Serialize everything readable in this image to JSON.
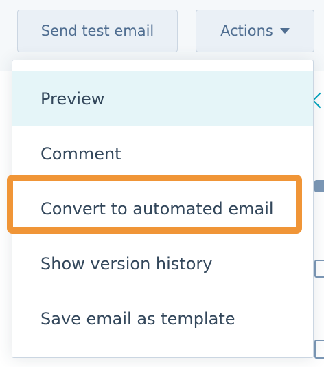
{
  "toolbar": {
    "send_test_label": "Send test email",
    "actions_label": "Actions"
  },
  "actions_menu": {
    "items": [
      {
        "label": "Preview",
        "state": "hovered"
      },
      {
        "label": "Comment"
      },
      {
        "label": "Convert to automated email",
        "highlighted": true
      },
      {
        "label": "Show version history"
      },
      {
        "label": "Save email as template"
      }
    ]
  },
  "sidebar_icons": [
    "chevron-left-icon",
    "module-icon",
    "layout-icon",
    "tool-icon"
  ],
  "colors": {
    "button_bg": "#eaf0f6",
    "button_text": "#506e91",
    "menu_hover_bg": "#e5f5f8",
    "highlight_border": "#f09537",
    "accent": "#00a4bd"
  }
}
